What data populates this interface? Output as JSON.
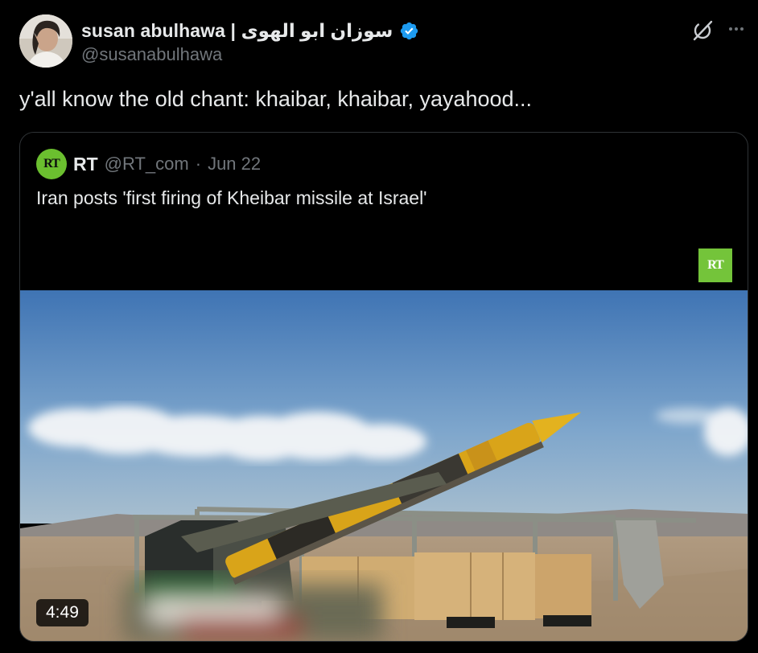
{
  "author": {
    "display_name": "susan abulhawa | سوزان ابو الهوى",
    "handle": "@susanabulhawa",
    "avatar": "avatar-photo",
    "verified_icon": "verified-badge-icon"
  },
  "header_actions": {
    "grok_icon": "grok-icon",
    "more_icon": "more-icon"
  },
  "tweet": {
    "text": "y'all know the old chant: khaibar, khaibar, yayahood..."
  },
  "quote": {
    "avatar_text": "RT",
    "author": "RT",
    "handle": "@RT_com",
    "separator": "·",
    "date": "Jun 22",
    "text": "Iran posts 'first firing of Kheibar missile at Israel'",
    "video": {
      "logo_text": "RT",
      "duration": "4:49"
    }
  },
  "colors": {
    "background": "#000000",
    "text": "#e7e9ea",
    "muted": "#71767b",
    "verified": "#1d9bf0",
    "rt_green": "#74c43a",
    "border": "#2f3336"
  }
}
